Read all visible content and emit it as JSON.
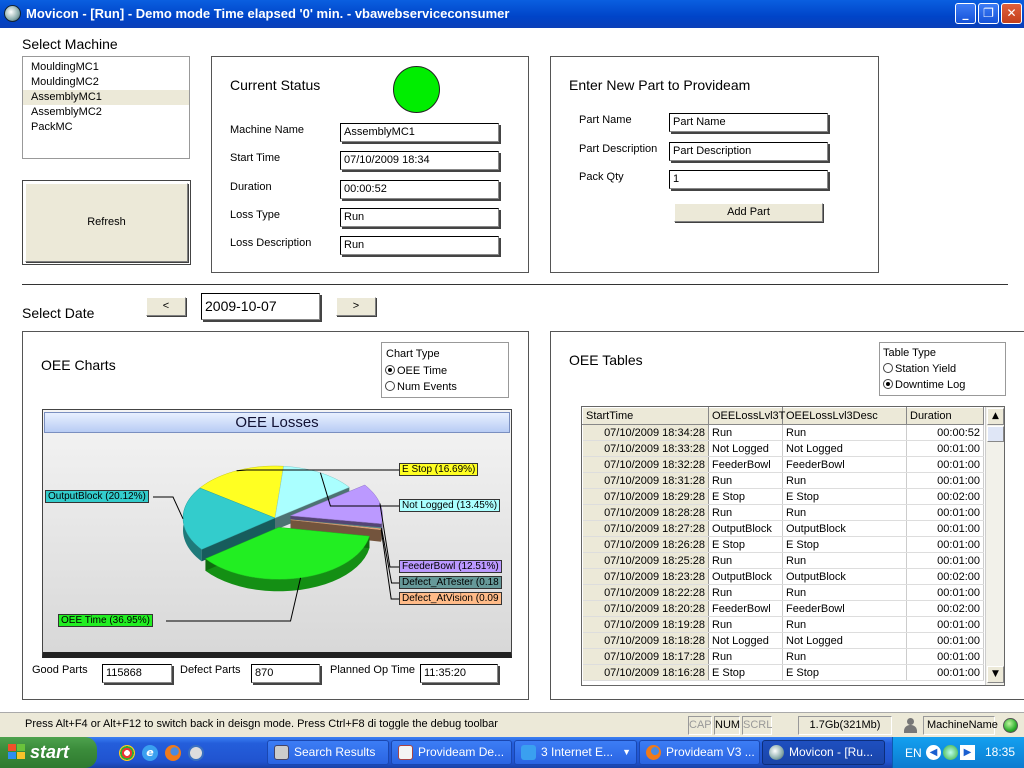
{
  "window": {
    "title": "Movicon - [Run] - Demo mode Time elapsed '0' min. - vbawebserviceconsumer"
  },
  "select_machine": {
    "label": "Select Machine",
    "items": [
      "MouldingMC1",
      "MouldingMC2",
      "AssemblyMC1",
      "AssemblyMC2",
      "PackMC"
    ],
    "selected": "AssemblyMC1",
    "refresh_label": "Refresh"
  },
  "current_status": {
    "title": "Current Status",
    "indicator_color": "#00ee00",
    "fields": {
      "machine_name": {
        "label": "Machine Name",
        "value": "AssemblyMC1"
      },
      "start_time": {
        "label": "Start Time",
        "value": "07/10/2009 18:34"
      },
      "duration": {
        "label": "Duration",
        "value": "00:00:52"
      },
      "loss_type": {
        "label": "Loss Type",
        "value": "Run"
      },
      "loss_description": {
        "label": "Loss Description",
        "value": "Run"
      }
    }
  },
  "new_part": {
    "title": "Enter New Part to Provideam",
    "part_name": {
      "label": "Part Name",
      "value": "Part Name"
    },
    "part_description": {
      "label": "Part Description",
      "value": "Part Description"
    },
    "pack_qty": {
      "label": "Pack Qty",
      "value": "1"
    },
    "add_label": "Add Part"
  },
  "select_date": {
    "label": "Select Date",
    "prev": "<",
    "next": ">",
    "value": "2009-10-07"
  },
  "oee_charts": {
    "title": "OEE Charts",
    "chart_type": {
      "label": "Chart Type",
      "options": [
        "OEE Time",
        "Num Events"
      ],
      "selected": "OEE Time"
    },
    "good_parts": {
      "label": "Good Parts",
      "value": "115868"
    },
    "defect_parts": {
      "label": "Defect Parts",
      "value": "870"
    },
    "planned_op_time": {
      "label": "Planned Op Time",
      "value": "11:35:20"
    }
  },
  "chart_data": {
    "type": "pie",
    "title": "OEE Losses",
    "slices": [
      {
        "label": "OEE Time (36.95%)",
        "name": "OEE Time",
        "value": 36.95,
        "color": "#22ee22",
        "exploded": true
      },
      {
        "label": "OutputBlock (20.12%)",
        "name": "OutputBlock",
        "value": 20.12,
        "color": "#33cccc"
      },
      {
        "label": "E Stop (16.69%)",
        "name": "E Stop",
        "value": 16.69,
        "color": "#ffff22"
      },
      {
        "label": "Not Logged (13.45%)",
        "name": "Not Logged",
        "value": 13.45,
        "color": "#aaffff"
      },
      {
        "label": "FeederBowl (12.51%)",
        "name": "FeederBowl",
        "value": 12.51,
        "color": "#bb99ff",
        "exploded": true
      },
      {
        "label": "Defect_AtTester (0.18",
        "name": "Defect_AtTester",
        "value": 0.18,
        "color": "#669999",
        "exploded": true
      },
      {
        "label": "Defect_AtVision (0.09",
        "name": "Defect_AtVision",
        "value": 0.09,
        "color": "#ffbb88",
        "exploded": true
      }
    ]
  },
  "oee_tables": {
    "title": "OEE Tables",
    "table_type": {
      "label": "Table Type",
      "options": [
        "Station Yield",
        "Downtime Log"
      ],
      "selected": "Downtime Log"
    },
    "columns": [
      "StartTime",
      "OEELossLvl3T",
      "OEELossLvl3Desc",
      "Duration"
    ],
    "rows": [
      [
        "07/10/2009 18:34:28",
        "Run",
        "Run",
        "00:00:52"
      ],
      [
        "07/10/2009 18:33:28",
        "Not Logged",
        "Not Logged",
        "00:01:00"
      ],
      [
        "07/10/2009 18:32:28",
        "FeederBowl",
        "FeederBowl",
        "00:01:00"
      ],
      [
        "07/10/2009 18:31:28",
        "Run",
        "Run",
        "00:01:00"
      ],
      [
        "07/10/2009 18:29:28",
        "E Stop",
        "E Stop",
        "00:02:00"
      ],
      [
        "07/10/2009 18:28:28",
        "Run",
        "Run",
        "00:01:00"
      ],
      [
        "07/10/2009 18:27:28",
        "OutputBlock",
        "OutputBlock",
        "00:01:00"
      ],
      [
        "07/10/2009 18:26:28",
        "E Stop",
        "E Stop",
        "00:01:00"
      ],
      [
        "07/10/2009 18:25:28",
        "Run",
        "Run",
        "00:01:00"
      ],
      [
        "07/10/2009 18:23:28",
        "OutputBlock",
        "OutputBlock",
        "00:02:00"
      ],
      [
        "07/10/2009 18:22:28",
        "Run",
        "Run",
        "00:01:00"
      ],
      [
        "07/10/2009 18:20:28",
        "FeederBowl",
        "FeederBowl",
        "00:02:00"
      ],
      [
        "07/10/2009 18:19:28",
        "Run",
        "Run",
        "00:01:00"
      ],
      [
        "07/10/2009 18:18:28",
        "Not Logged",
        "Not Logged",
        "00:01:00"
      ],
      [
        "07/10/2009 18:17:28",
        "Run",
        "Run",
        "00:01:00"
      ],
      [
        "07/10/2009 18:16:28",
        "E Stop",
        "E Stop",
        "00:01:00"
      ]
    ]
  },
  "statusbar": {
    "message": "Press Alt+F4 or Alt+F12 to switch back in deisgn mode. Press Ctrl+F8 di toggle the debug toolbar",
    "cap": "CAP",
    "num": "NUM",
    "scrl": "SCRL",
    "memory": "1.7Gb(321Mb)",
    "user": "MachineName"
  },
  "taskbar": {
    "start": "start",
    "tasks": [
      "Search Results",
      "Provideam De...",
      "3 Internet E...",
      "Provideam V3 ...",
      "Movicon - [Ru..."
    ],
    "lang": "EN",
    "clock": "18:35"
  }
}
